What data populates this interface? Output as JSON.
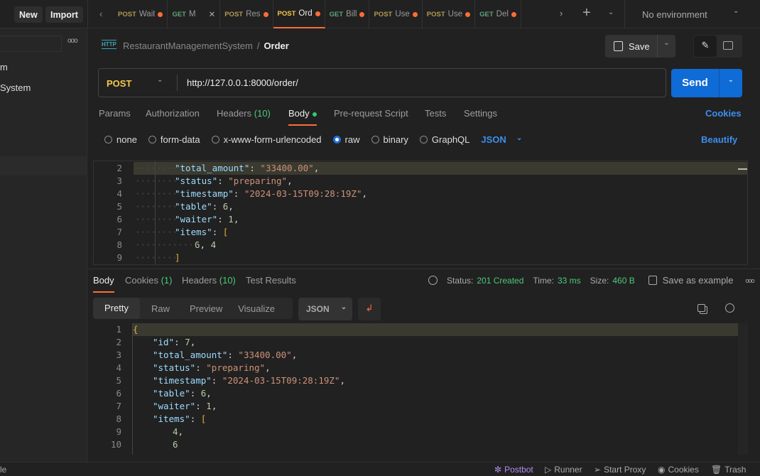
{
  "topbar": {
    "new": "New",
    "import": "Import",
    "environment": "No environment",
    "tabs": [
      {
        "method": "POST",
        "label": "Wait",
        "dot": true
      },
      {
        "method": "GET",
        "label": "M",
        "close": true
      },
      {
        "method": "POST",
        "label": "Res",
        "dot": true
      },
      {
        "method": "POST",
        "label": "Ord",
        "dot": true,
        "active": true
      },
      {
        "method": "GET",
        "label": "Bill",
        "dot": true
      },
      {
        "method": "POST",
        "label": "Use",
        "dot": true
      },
      {
        "method": "POST",
        "label": "Use",
        "dot": true
      },
      {
        "method": "GET",
        "label": "Del",
        "dot": true
      }
    ]
  },
  "sidebar": {
    "items": [
      "m",
      "System"
    ],
    "footer": "le"
  },
  "breadcrumb": {
    "collection": "RestaurantManagementSystem",
    "sep": "/",
    "request": "Order"
  },
  "actions": {
    "save": "Save",
    "send": "Send"
  },
  "request": {
    "method": "POST",
    "url": "http://127.0.0.1:8000/order/"
  },
  "req_tabs": {
    "params": "Params",
    "auth": "Authorization",
    "headers": "Headers",
    "headers_count": "(10)",
    "body": "Body",
    "pre": "Pre-request Script",
    "tests": "Tests",
    "settings": "Settings",
    "cookies": "Cookies"
  },
  "body_modes": {
    "none": "none",
    "form": "form-data",
    "urlenc": "x-www-form-urlencoded",
    "raw": "raw",
    "binary": "binary",
    "graphql": "GraphQL",
    "lang": "JSON",
    "beautify": "Beautify",
    "selected": "raw"
  },
  "request_body": [
    {
      "n": "2",
      "t": [
        [
          "k",
          "\"total_amount\""
        ],
        [
          "p",
          ": "
        ],
        [
          "s",
          "\"33400.00\""
        ],
        [
          "p",
          ","
        ]
      ]
    },
    {
      "n": "3",
      "t": [
        [
          "k",
          "\"status\""
        ],
        [
          "p",
          ": "
        ],
        [
          "s",
          "\"preparing\""
        ],
        [
          "p",
          ","
        ]
      ]
    },
    {
      "n": "4",
      "t": [
        [
          "k",
          "\"timestamp\""
        ],
        [
          "p",
          ": "
        ],
        [
          "s",
          "\"2024-03-15T09:28:19Z\""
        ],
        [
          "p",
          ","
        ]
      ]
    },
    {
      "n": "5",
      "t": [
        [
          "k",
          "\"table\""
        ],
        [
          "p",
          ": "
        ],
        [
          "n",
          "6"
        ],
        [
          "p",
          ","
        ]
      ]
    },
    {
      "n": "6",
      "t": [
        [
          "k",
          "\"waiter\""
        ],
        [
          "p",
          ": "
        ],
        [
          "n",
          "1"
        ],
        [
          "p",
          ","
        ]
      ]
    },
    {
      "n": "7",
      "t": [
        [
          "k",
          "\"items\""
        ],
        [
          "p",
          ": "
        ],
        [
          "br",
          "["
        ]
      ]
    },
    {
      "n": "8",
      "indent": 2,
      "t": [
        [
          "n",
          "6"
        ],
        [
          "p",
          ", "
        ],
        [
          "n",
          "4"
        ]
      ]
    },
    {
      "n": "9",
      "t": [
        [
          "br",
          "]"
        ]
      ]
    }
  ],
  "resp_tabs": {
    "body": "Body",
    "cookies": "Cookies",
    "cookies_count": "(1)",
    "headers": "Headers",
    "headers_count": "(10)",
    "tests": "Test Results"
  },
  "response_meta": {
    "status_label": "Status:",
    "status": "201 Created",
    "time_label": "Time:",
    "time": "33 ms",
    "size_label": "Size:",
    "size": "460 B",
    "save_example": "Save as example"
  },
  "resp_view": {
    "pretty": "Pretty",
    "raw": "Raw",
    "preview": "Preview",
    "visualize": "Visualize",
    "lang": "JSON"
  },
  "response_body": [
    {
      "n": "1",
      "i": 0,
      "t": [
        [
          "br",
          "{"
        ]
      ]
    },
    {
      "n": "2",
      "i": 1,
      "t": [
        [
          "k",
          "\"id\""
        ],
        [
          "p",
          ": "
        ],
        [
          "n",
          "7"
        ],
        [
          "p",
          ","
        ]
      ]
    },
    {
      "n": "3",
      "i": 1,
      "t": [
        [
          "k",
          "\"total_amount\""
        ],
        [
          "p",
          ": "
        ],
        [
          "s",
          "\"33400.00\""
        ],
        [
          "p",
          ","
        ]
      ]
    },
    {
      "n": "4",
      "i": 1,
      "t": [
        [
          "k",
          "\"status\""
        ],
        [
          "p",
          ": "
        ],
        [
          "s",
          "\"preparing\""
        ],
        [
          "p",
          ","
        ]
      ]
    },
    {
      "n": "5",
      "i": 1,
      "t": [
        [
          "k",
          "\"timestamp\""
        ],
        [
          "p",
          ": "
        ],
        [
          "s",
          "\"2024-03-15T09:28:19Z\""
        ],
        [
          "p",
          ","
        ]
      ]
    },
    {
      "n": "6",
      "i": 1,
      "t": [
        [
          "k",
          "\"table\""
        ],
        [
          "p",
          ": "
        ],
        [
          "n",
          "6"
        ],
        [
          "p",
          ","
        ]
      ]
    },
    {
      "n": "7",
      "i": 1,
      "t": [
        [
          "k",
          "\"waiter\""
        ],
        [
          "p",
          ": "
        ],
        [
          "n",
          "1"
        ],
        [
          "p",
          ","
        ]
      ]
    },
    {
      "n": "8",
      "i": 1,
      "t": [
        [
          "k",
          "\"items\""
        ],
        [
          "p",
          ": "
        ],
        [
          "br",
          "["
        ]
      ]
    },
    {
      "n": "9",
      "i": 2,
      "t": [
        [
          "n",
          "4"
        ],
        [
          "p",
          ","
        ]
      ]
    },
    {
      "n": "10",
      "i": 2,
      "t": [
        [
          "n",
          "6"
        ]
      ]
    }
  ],
  "statusbar": {
    "postbot": "Postbot",
    "runner": "Runner",
    "proxy": "Start Proxy",
    "cookies": "Cookies",
    "trash": "Trash"
  },
  "colors": {
    "accent": "#ff6c37",
    "send": "#0f6bd6",
    "post": "#f5c84c",
    "get": "#5fa37a",
    "success": "#4cc97a"
  }
}
